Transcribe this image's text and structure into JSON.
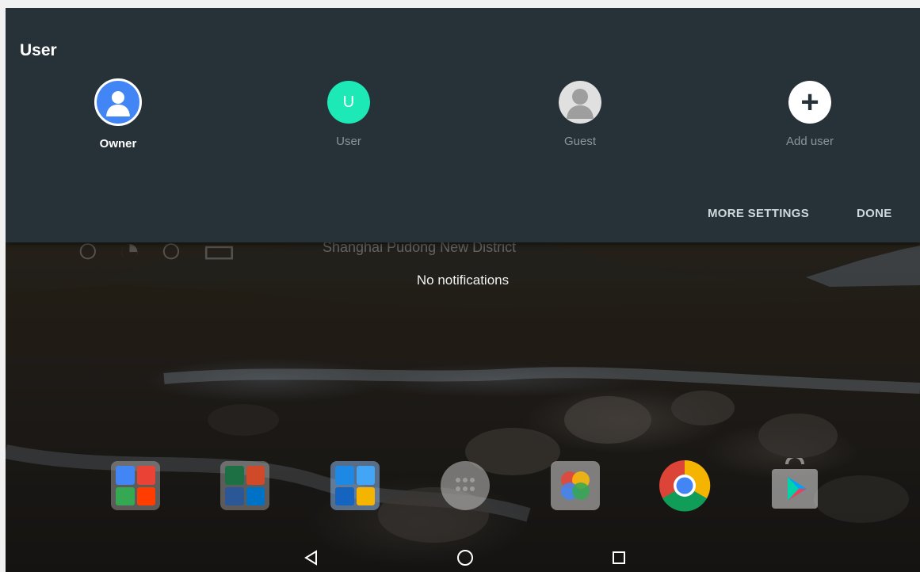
{
  "panel": {
    "title": "User",
    "users": [
      {
        "label": "Owner",
        "icon": "owner-avatar-icon",
        "active": true
      },
      {
        "label": "User",
        "initial": "U",
        "icon": "user-avatar-icon",
        "active": false
      },
      {
        "label": "Guest",
        "icon": "guest-avatar-icon",
        "active": false
      },
      {
        "label": "Add user",
        "icon": "add-user-icon",
        "symbol": "+",
        "active": false
      }
    ],
    "more_settings_label": "MORE SETTINGS",
    "done_label": "DONE"
  },
  "lockscreen": {
    "location": "Shanghai Pudong New District",
    "no_notifications": "No notifications"
  },
  "dock": {
    "items": [
      {
        "name": "google-folder-icon"
      },
      {
        "name": "office-folder-icon"
      },
      {
        "name": "lenovo-folder-icon"
      },
      {
        "name": "app-drawer-icon"
      },
      {
        "name": "photos-app-icon"
      },
      {
        "name": "chrome-app-icon"
      },
      {
        "name": "play-store-icon"
      }
    ]
  },
  "navbar": {
    "back": "back-icon",
    "home": "home-icon",
    "recents": "recents-icon"
  },
  "colors": {
    "panel_bg": "#263238",
    "owner_blue": "#4285f4",
    "user_teal": "#1de9b6"
  }
}
